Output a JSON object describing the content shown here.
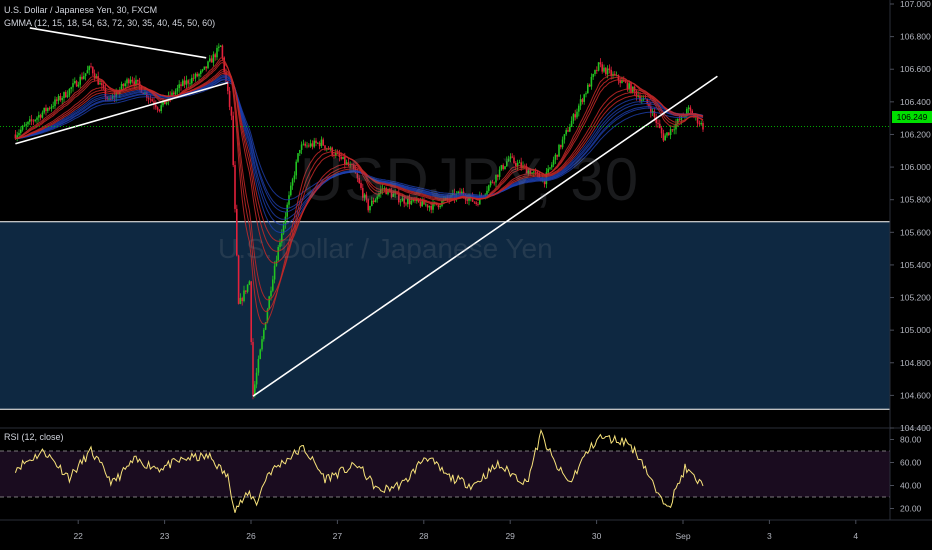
{
  "symbol_watermark": "USDJPY, 30",
  "description_watermark": "U.S. Dollar / Japanese Yen",
  "legend": {
    "title": "U.S. Dollar / Japanese Yen, 30, FXCM",
    "gmma": "GMMA (12, 15, 18, 54, 63, 72, 30, 35, 40, 45, 50, 60)",
    "rsi": "RSI (12, close)"
  },
  "price_axis": {
    "ticks": [
      "107.000",
      "106.800",
      "106.600",
      "106.400",
      "106.200",
      "106.000",
      "105.800",
      "105.600",
      "105.400",
      "105.200",
      "105.000",
      "104.800",
      "104.600",
      "104.400"
    ],
    "current_price": "106.249"
  },
  "rsi_axis": {
    "ticks": [
      "80.00",
      "60.00",
      "40.00",
      "20.00"
    ]
  },
  "time_axis": {
    "labels": [
      "22",
      "23",
      "26",
      "27",
      "28",
      "29",
      "30",
      "Sep",
      "3",
      "4"
    ]
  },
  "colors": {
    "background": "#000000",
    "candle_up": "#22c322",
    "candle_down": "#e3213b",
    "gmma_short": "#c62828",
    "gmma_long": "#1e40af",
    "zone_fill": "#0f2a44",
    "rsi_line": "#f7e27a",
    "rsi_band": "#1a0c1f",
    "price_line": "#00e000"
  },
  "chart_data": {
    "type": "candlestick",
    "price_range": [
      104.4,
      107.0
    ],
    "rsi_range": [
      10,
      90
    ],
    "rsi_levels": [
      70,
      30
    ],
    "support_zone": [
      104.515,
      105.665
    ],
    "current_price": 106.249,
    "trendlines": [
      {
        "from": [
          "21 10:00",
          106.853
        ],
        "to": [
          "23 11:00",
          106.67
        ]
      },
      {
        "from": [
          "21 06:00",
          106.143
        ],
        "to": [
          "23 17:00",
          106.517
        ]
      },
      {
        "from": [
          "26 00:00",
          104.595
        ],
        "to": [
          "31 09:00",
          106.557
        ]
      }
    ],
    "anchors": [
      [
        "21 06:00",
        106.2
      ],
      [
        "21 20:00",
        106.45
      ],
      [
        "22 03:00",
        106.61
      ],
      [
        "22 08:00",
        106.4
      ],
      [
        "22 14:00",
        106.55
      ],
      [
        "22 22:00",
        106.36
      ],
      [
        "23 04:00",
        106.5
      ],
      [
        "23 10:00",
        106.58
      ],
      [
        "23 15:00",
        106.74
      ],
      [
        "23 18:00",
        106.3
      ],
      [
        "23 20:00",
        105.15
      ],
      [
        "23 23:00",
        105.3
      ],
      [
        "26 00:00",
        104.6
      ],
      [
        "26 06:00",
        105.4
      ],
      [
        "26 13:00",
        106.12
      ],
      [
        "26 19:00",
        106.15
      ],
      [
        "27 04:00",
        105.98
      ],
      [
        "27 08:00",
        105.75
      ],
      [
        "27 12:00",
        105.87
      ],
      [
        "27 17:00",
        105.8
      ],
      [
        "28 02:00",
        105.76
      ],
      [
        "28 10:00",
        105.84
      ],
      [
        "28 14:00",
        105.78
      ],
      [
        "28 23:00",
        106.05
      ],
      [
        "29 09:00",
        105.92
      ],
      [
        "29 19:00",
        106.4
      ],
      [
        "30 00:00",
        106.62
      ],
      [
        "30 08:00",
        106.5
      ],
      [
        "30 14:00",
        106.38
      ],
      [
        "30 18:00",
        106.18
      ],
      [
        "31 01:00",
        106.35
      ],
      [
        "31 05:00",
        106.249
      ]
    ],
    "rsi_anchors": [
      [
        "21 06:00",
        55
      ],
      [
        "21 14:00",
        70
      ],
      [
        "21 21:00",
        47
      ],
      [
        "22 03:00",
        70
      ],
      [
        "22 09:00",
        42
      ],
      [
        "22 15:00",
        62
      ],
      [
        "22 22:00",
        55
      ],
      [
        "23 06:00",
        64
      ],
      [
        "23 12:00",
        65
      ],
      [
        "23 17:00",
        47
      ],
      [
        "23 19:00",
        20
      ],
      [
        "23 23:00",
        33
      ],
      [
        "26 01:00",
        25
      ],
      [
        "26 04:00",
        50
      ],
      [
        "26 09:00",
        62
      ],
      [
        "26 14:00",
        73
      ],
      [
        "26 20:00",
        46
      ],
      [
        "27 05:00",
        58
      ],
      [
        "27 11:00",
        35
      ],
      [
        "27 18:00",
        42
      ],
      [
        "28 00:00",
        66
      ],
      [
        "28 06:00",
        48
      ],
      [
        "28 13:00",
        40
      ],
      [
        "28 20:00",
        58
      ],
      [
        "29 04:00",
        42
      ],
      [
        "29 08:00",
        85
      ],
      [
        "29 12:00",
        58
      ],
      [
        "29 16:00",
        42
      ],
      [
        "29 20:00",
        65
      ],
      [
        "30 00:00",
        82
      ],
      [
        "30 04:00",
        80
      ],
      [
        "30 08:00",
        78
      ],
      [
        "30 12:00",
        62
      ],
      [
        "30 17:00",
        28
      ],
      [
        "30 20:00",
        25
      ],
      [
        "31 00:00",
        55
      ],
      [
        "31 04:00",
        42
      ],
      [
        "31 05:00",
        43
      ]
    ],
    "date_labels": [
      "22",
      "23",
      "26",
      "27",
      "28",
      "29",
      "30",
      "Sep",
      "3",
      "4"
    ]
  }
}
